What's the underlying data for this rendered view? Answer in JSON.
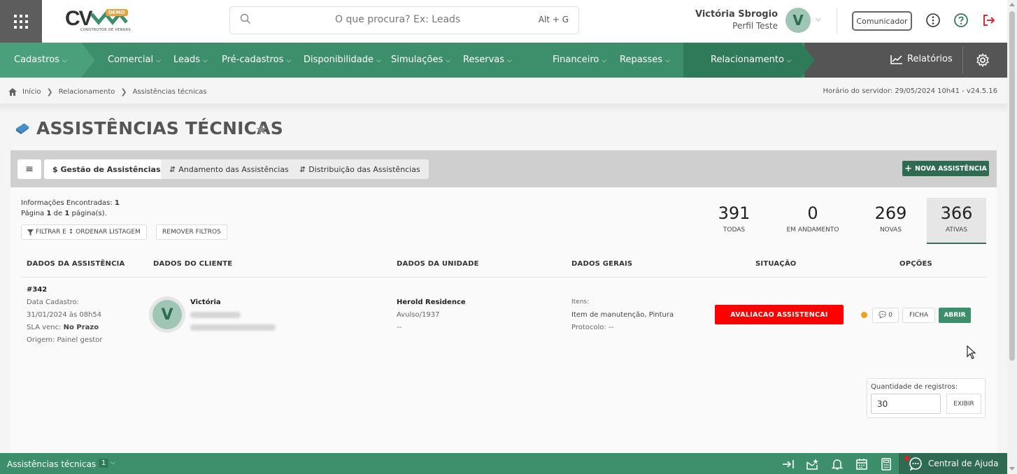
{
  "header": {
    "logo_text": "CV",
    "logo_badge": "DEMO",
    "logo_subtitle": "CONSTRUTOR DE VENDAS",
    "search_placeholder": "O que procura? Ex: Leads",
    "search_shortcut": "Alt + G",
    "user_name": "Victória Sbrogio",
    "user_role": "Perfil Teste",
    "user_initial": "V",
    "communicator_label": "Comunicador"
  },
  "nav": {
    "items": [
      "Cadastros",
      "Comercial",
      "Leads",
      "Pré-cadastros",
      "Disponibilidade",
      "Simulações",
      "Reservas",
      "Financeiro",
      "Repasses",
      "Relacionamento"
    ],
    "reports_label": "Relatórios"
  },
  "breadcrumb": {
    "items": [
      "Início",
      "Relacionamento",
      "Assistências técnicas"
    ],
    "server_time": "Horário do servidor: 29/05/2024 10h41 - v24.5.16"
  },
  "page": {
    "title": "ASSISTÊNCIAS TÉCNICAS"
  },
  "tabs": {
    "items": [
      "$ Gestão de Assistências",
      "Andamento das Assistências",
      "Distribuição das Assistências"
    ],
    "new_button": "NOVA ASSISTÊNCIA"
  },
  "info": {
    "found_label": "Informações Encontradas:",
    "found_value": "1",
    "page_prefix": "Página",
    "page_current": "1",
    "page_of": "de",
    "page_total": "1",
    "page_suffix": "página(s).",
    "filter_button": "FILTRAR E ↕ ORDENAR LISTAGEM",
    "remove_filters_button": "REMOVER FILTROS"
  },
  "stats": [
    {
      "value": "391",
      "label": "TODAS"
    },
    {
      "value": "0",
      "label": "EM ANDAMENTO"
    },
    {
      "value": "269",
      "label": "NOVAS"
    },
    {
      "value": "366",
      "label": "ATIVAS"
    }
  ],
  "table": {
    "headers": [
      "DADOS DA ASSISTÊNCIA",
      "DADOS DO CLIENTE",
      "DADOS DA UNIDADE",
      "DADOS GERAIS",
      "SITUAÇÃO",
      "OPÇÕES"
    ],
    "row": {
      "id": "#342",
      "date_label": "Data Cadastro:",
      "date_value": "31/01/2024 às 08h54",
      "sla_label": "SLA venc:",
      "sla_value": "No Prazo",
      "origin": "Origem: Painel gestor",
      "client_initial": "V",
      "client_name": "Victória",
      "unit_name": "Herold Residence",
      "unit_sub": "Avulso/1937",
      "unit_extra": "--",
      "items_label": "Itens:",
      "items_value": "Item de manutenção, Pintura",
      "protocol": "Protocolo: --",
      "status": "AVALIACAO ASSISTENCAI",
      "comments_count": "0",
      "sheet_button": "FICHA",
      "open_button": "ABRIR"
    }
  },
  "pagination": {
    "label": "Quantidade de registros:",
    "value": "30",
    "button": "EXIBIR"
  },
  "footer": {
    "title": "Assistências técnicas",
    "count": "1",
    "help_label": "Central de Ajuda"
  },
  "colors": {
    "nav_green": "#3d8f6b",
    "accent_dark": "#2f6b52",
    "status_red": "#ff0000",
    "logout_red": "#d32f2f"
  }
}
